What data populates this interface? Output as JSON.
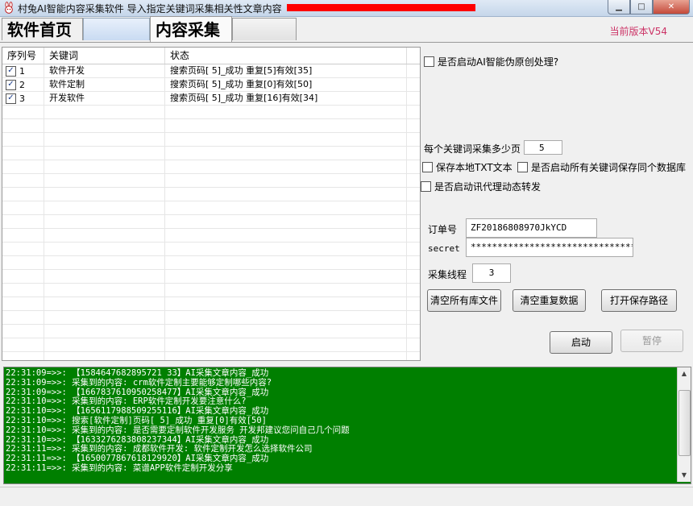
{
  "window": {
    "title": "村兔AI智能内容采集软件 导入指定关键词采集相关性文章内容"
  },
  "tabs": [
    {
      "label": "软件首页"
    },
    {
      "label": ""
    },
    {
      "label": "内容采集"
    },
    {
      "label": ""
    }
  ],
  "version": "当前版本V54",
  "table": {
    "headers": [
      "序列号",
      "关键词",
      "状态"
    ],
    "rows": [
      {
        "checked": true,
        "index": "1",
        "keyword": "软件开发",
        "status": "搜索页码[ 5]_成功 重复[5]有效[35]"
      },
      {
        "checked": true,
        "index": "2",
        "keyword": "软件定制",
        "status": "搜索页码[ 5]_成功 重复[0]有效[50]"
      },
      {
        "checked": true,
        "index": "3",
        "keyword": "开发软件",
        "status": "搜索页码[ 5]_成功 重复[16]有效[34]"
      }
    ]
  },
  "settings": {
    "ai_rewrite_label": "是否启动AI智能伪原创处理?",
    "pages_per_keyword_label": "每个关键词采集多少页",
    "pages_per_keyword_value": "5",
    "save_txt_label": "保存本地TXT文本",
    "same_db_label": "是否启动所有关键词保存同个数据库",
    "proxy_label": "是否启动讯代理动态转发",
    "order_label": "订单号",
    "order_value": "ZF20186808970JkYCD",
    "secret_label": "secret",
    "secret_value": "********************************",
    "threads_label": "采集线程",
    "threads_value": "3"
  },
  "buttons": {
    "clear_lib": "清空所有库文件",
    "clear_dup": "清空重复数据",
    "open_path": "打开保存路径",
    "start": "启动",
    "pause": "暂停"
  },
  "log": [
    "22:31:09=>>: 【1584647682895721 33】AI采集文章内容_成功",
    "22:31:09=>>: 采集到的内容: crm软件定制主要能够定制哪些内容?",
    "22:31:09=>>: 【1667837610950258477】AI采集文章内容_成功",
    "22:31:10=>>: 采集到的内容: ERP软件定制开发要注意什么?",
    "22:31:10=>>: 【1656117988509255116】AI采集文章内容_成功",
    "22:31:10=>>: 搜索[软件定制]页码[ 5]_成功 重复[0]有效[50]",
    "22:31:10=>>: 采集到的内容: 是否需要定制软件开发服务 开发邦建议您问自己几个问题",
    "22:31:10=>>: 【1633276283808237344】AI采集文章内容_成功",
    "22:31:11=>>: 采集到的内容: 成都软件开发: 软件定制开发怎么选择软件公司",
    "22:31:11=>>: 【1650077867618129920】AI采集文章内容_成功",
    "22:31:11=>>: 采集到的内容: 菜谱APP软件定制开发分享"
  ]
}
